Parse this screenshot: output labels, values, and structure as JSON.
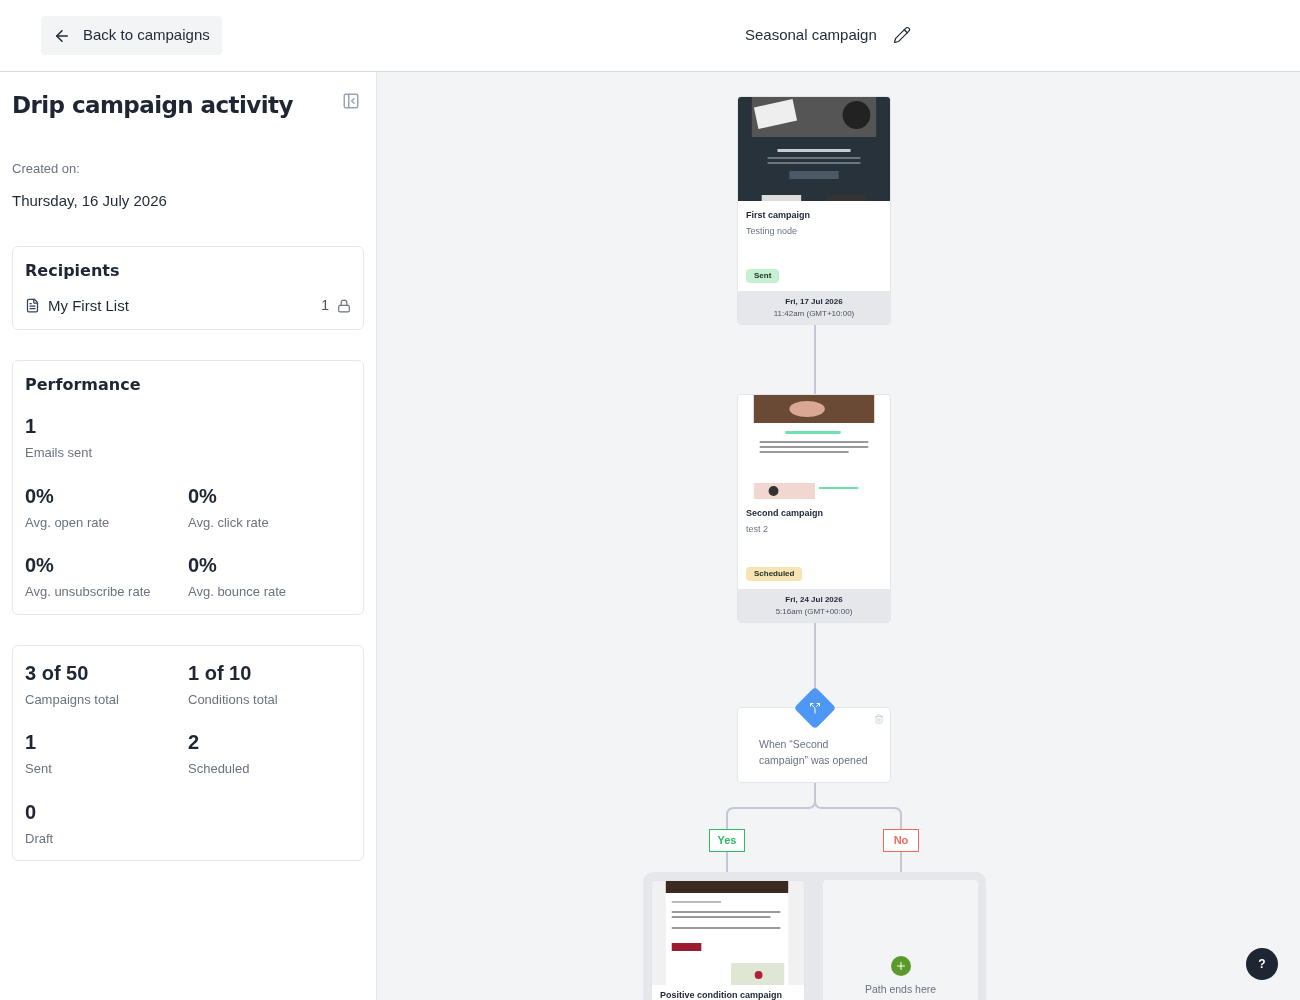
{
  "header": {
    "back_label": "Back to campaigns",
    "campaign_title": "Seasonal campaign"
  },
  "sidebar": {
    "title": "Drip campaign activity",
    "created_label": "Created on:",
    "created_date": "Thursday, 16 July 2026",
    "recipients": {
      "title": "Recipients",
      "lists": [
        {
          "name": "My First List",
          "count": "1"
        }
      ]
    },
    "performance": {
      "title": "Performance",
      "emails_sent": {
        "value": "1",
        "label": "Emails sent"
      },
      "metrics": [
        {
          "value": "0%",
          "label": "Avg. open rate"
        },
        {
          "value": "0%",
          "label": "Avg. click rate"
        },
        {
          "value": "0%",
          "label": "Avg. unsubscribe rate"
        },
        {
          "value": "0%",
          "label": "Avg. bounce rate"
        }
      ]
    },
    "totals": [
      {
        "value": "3 of 50",
        "label": "Campaigns total"
      },
      {
        "value": "1 of 10",
        "label": "Conditions total"
      },
      {
        "value": "1",
        "label": "Sent"
      },
      {
        "value": "2",
        "label": "Scheduled"
      },
      {
        "value": "0",
        "label": "Draft"
      }
    ]
  },
  "canvas": {
    "campaigns": [
      {
        "title": "First campaign",
        "subtitle": "Testing node",
        "status": "Sent",
        "color": "#c6f0d4",
        "date": "Fri, 17 Jul 2026",
        "time": "11:42am (GMT+10:00)"
      },
      {
        "title": "Second campaign",
        "subtitle": "test 2",
        "status": "Scheduled",
        "color": "#f7e4b3",
        "date": "Fri, 24 Jul 2026",
        "time": "5:16am (GMT+00:00)"
      }
    ],
    "condition": {
      "text": "When “Second campaign” was opened"
    },
    "branches": [
      {
        "label": "Yes",
        "kind": "yes"
      },
      {
        "label": "No",
        "kind": "no"
      }
    ],
    "positive_campaign": {
      "title": "Positive condition campaign"
    },
    "empty_path": {
      "text": "Path ends here"
    }
  },
  "help": {
    "label": "?"
  }
}
